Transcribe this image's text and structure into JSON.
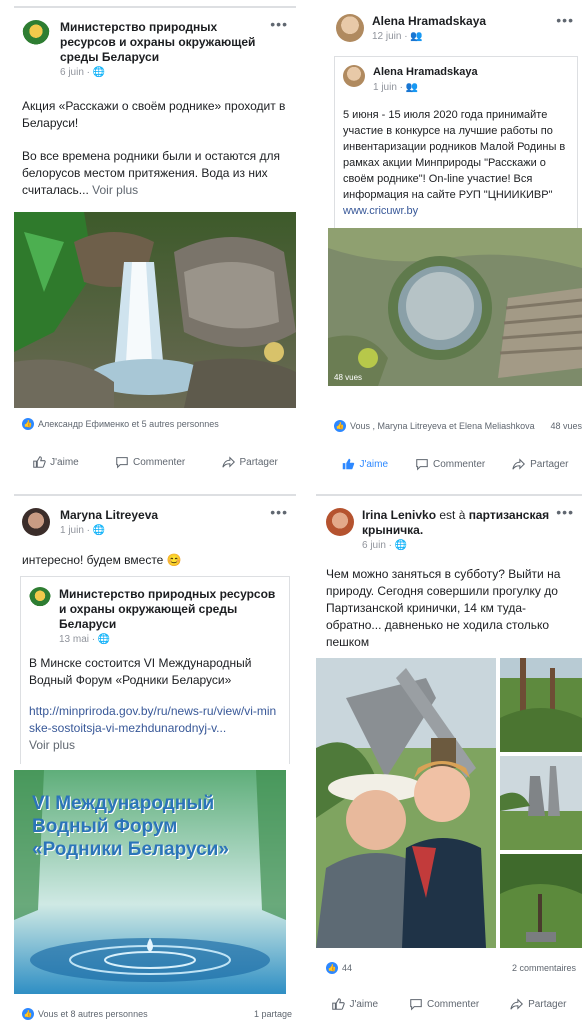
{
  "post1": {
    "author": "Министерство природных ресурсов и охраны окружающей среды Беларуси",
    "date": "6 juin",
    "more": "•••",
    "text1": "Акция «Расскажи о своём роднике» проходит в Беларуси!",
    "text2": "Во все времена родники были и остаются для белорусов местом притяжения. Вода из них считалась...",
    "see_more": "Voir plus",
    "reactions": "Александр Ефименко et 5 autres personnes",
    "like": "J'aime",
    "comment": "Commenter",
    "share": "Partager"
  },
  "post2": {
    "author": "Alena Hramadskaya",
    "date": "12 juin",
    "more": "•••",
    "inner_author": "Alena Hramadskaya",
    "inner_date": "1 juin",
    "inner_text": "5 июня - 15 июля 2020 года принимайте участие в конкурсе на лучшие работы по инвентаризации родников Малой Родины в рамках акции Минприроды \"Расскажи о своём роднике\"! On-line участие! Вся информация на сайте РУП \"ЦНИИКИВР\"",
    "inner_link": "www.cricuwr.by",
    "views": "48 vues",
    "reactions": "Vous , Maryna Litreyeva et Elena Meliashkova",
    "views_count": "48 vues",
    "like": "J'aime",
    "comment": "Commenter",
    "share": "Partager"
  },
  "post3": {
    "author": "Maryna Litreyeva",
    "date": "1 juin",
    "more": "•••",
    "text": "интересно! будем вместе",
    "inner_author": "Министерство природных ресурсов и охраны окружающей среды Беларуси",
    "inner_date": "13 mai",
    "inner_text": "В Минске состоится VI Международный Водный Форум «Родники Беларуси»",
    "inner_link": "http://minpriroda.gov.by/ru/news-ru/view/vi-minske-sostoitsja-vi-mezhdunarodnyj-v...",
    "see_more": "Voir plus",
    "image_title": "VI Международный Водный Форум «Родники Беларуси»",
    "reactions": "Vous et 8 autres personnes",
    "shares": "1 partage"
  },
  "post4": {
    "author": "Irina Lenivko",
    "checkin_word": "est à",
    "place": "партизанская крыничка",
    "date": "6 juin",
    "more": "•••",
    "text": "Чем можно заняться в субботу? Выйти на природу. Сегодня совершили прогулку до Партизанской кринички, 14 км туда-обратно... давненько не ходила столько пешком",
    "likes": "44",
    "comments": "2 commentaires",
    "like": "J'aime",
    "comment": "Commenter",
    "share": "Partager"
  },
  "colors": {
    "accent": "#385898",
    "like_blue": "#2d88ff",
    "muted": "#606770"
  }
}
